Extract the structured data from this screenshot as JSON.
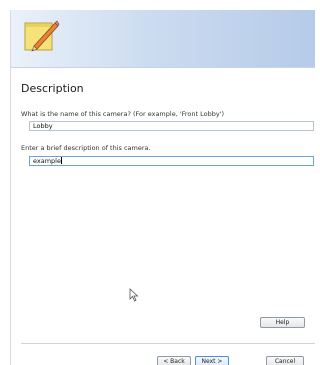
{
  "page": {
    "title": "Description"
  },
  "fields": {
    "name_label": "What is the name of this camera? (For example, 'Front Lobby')",
    "name_value": "Lobby",
    "description_label": "Enter a brief description of this camera.",
    "description_value": "example"
  },
  "buttons": {
    "help": "Help",
    "back": "< Back",
    "next": "Next >",
    "cancel": "Cancel"
  },
  "icons": {
    "header": "pencil-notepad-icon",
    "cursor": "mouse-pointer-icon"
  },
  "colors": {
    "banner_start": "#eaf1fa",
    "banner_end": "#b5cbe8",
    "notepad": "#f5e27a",
    "focus_border": "#6aa2dc"
  }
}
